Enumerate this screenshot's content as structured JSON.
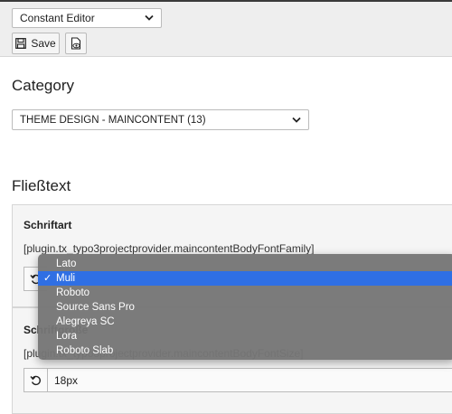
{
  "toolbar": {
    "module_select": "Constant Editor",
    "save_label": "Save"
  },
  "category": {
    "heading": "Category",
    "select_value": "THEME DESIGN - MAINCONTENT (13)"
  },
  "section": {
    "heading": "Fließtext"
  },
  "fields": [
    {
      "title": "Schriftart",
      "key": "[plugin.tx_typo3projectprovider.maincontentBodyFontFamily]"
    },
    {
      "title": "Schriftgröße",
      "key": "[plugin.tx_typo3projectprovider.maincontentBodyFontSize]",
      "value": "18px"
    }
  ],
  "dropdown": {
    "options": [
      "Lato",
      "Muli",
      "Roboto",
      "Source Sans Pro",
      "Alegreya SC",
      "Lora",
      "Roboto Slab"
    ],
    "selected": "Muli",
    "check_glyph": "✓"
  },
  "colors": {
    "selection": "#2f6fe4",
    "menu_bg": "#767676",
    "toolbar_bg": "#eeeeee",
    "panel_bg": "#f5f5f5"
  },
  "icons": [
    "chevron-down-icon",
    "save-icon",
    "view-page-icon",
    "reset-icon",
    "check-icon"
  ]
}
